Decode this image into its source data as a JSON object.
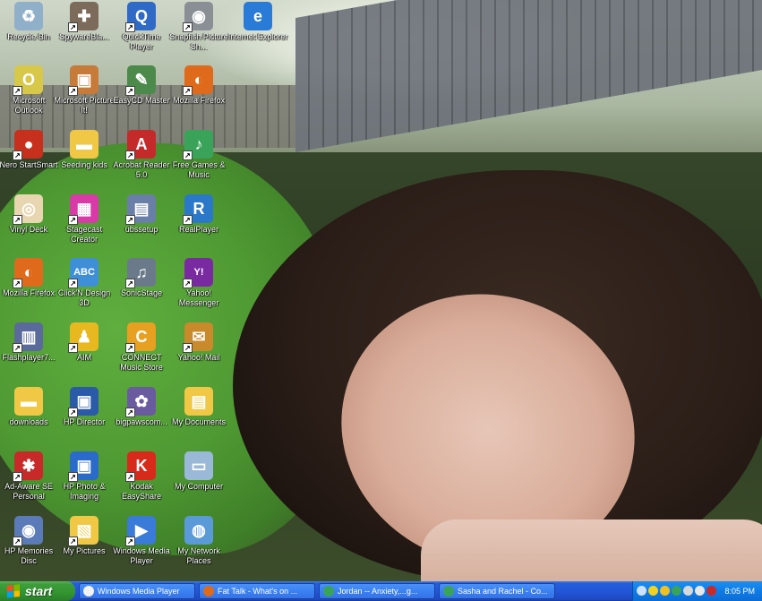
{
  "desktop": {
    "icons": [
      {
        "label": "Recycle Bin",
        "icon": "recycle-bin-icon",
        "color": "#8fb0c8",
        "glyph": "♻",
        "shortcut": false
      },
      {
        "label": "SpywareBla...",
        "icon": "spyware-blaster-icon",
        "color": "#7c6a5a",
        "glyph": "✚",
        "shortcut": true
      },
      {
        "label": "QuickTime Player",
        "icon": "quicktime-icon",
        "color": "#2f6bc6",
        "glyph": "Q",
        "shortcut": true
      },
      {
        "label": "Snapfish Picture Sh...",
        "icon": "snapfish-icon",
        "color": "#8a8f96",
        "glyph": "◉",
        "shortcut": true
      },
      {
        "label": "Internet Explorer",
        "icon": "internet-explorer-icon",
        "color": "#2a7ad8",
        "glyph": "e",
        "shortcut": false
      },
      {
        "label": "Microsoft Outlook",
        "icon": "outlook-icon",
        "color": "#d8c84a",
        "glyph": "O",
        "shortcut": true
      },
      {
        "label": "Microsoft Picture It!",
        "icon": "picture-it-icon",
        "color": "#c77b3a",
        "glyph": "▣",
        "shortcut": true
      },
      {
        "label": "EasyCD Master",
        "icon": "easycd-icon",
        "color": "#4c8a4c",
        "glyph": "✎",
        "shortcut": true
      },
      {
        "label": "Mozilla Firefox",
        "icon": "firefox-icon",
        "color": "#e06a1c",
        "glyph": "◐",
        "shortcut": true
      },
      {
        "label": "Nero StartSmart",
        "icon": "nero-icon",
        "color": "#c8301e",
        "glyph": "●",
        "shortcut": true
      },
      {
        "label": "Seeding kids",
        "icon": "folder-icon",
        "color": "#f0c845",
        "glyph": "▬",
        "shortcut": false
      },
      {
        "label": "Acrobat Reader 5.0",
        "icon": "acrobat-icon",
        "color": "#c42a2a",
        "glyph": "A",
        "shortcut": true
      },
      {
        "label": "Free Games & Music",
        "icon": "free-games-icon",
        "color": "#3aa35a",
        "glyph": "♪",
        "shortcut": true
      },
      {
        "label": "Vinyl Deck",
        "icon": "vinyl-deck-icon",
        "color": "#e8d6b0",
        "glyph": "◎",
        "shortcut": true
      },
      {
        "label": "Stagecast Creator",
        "icon": "stagecast-icon",
        "color": "#d83aa8",
        "glyph": "▦",
        "shortcut": true
      },
      {
        "label": "ubssetup",
        "icon": "setup-icon",
        "color": "#6a7fa8",
        "glyph": "▤",
        "shortcut": true
      },
      {
        "label": "RealPlayer",
        "icon": "realplayer-icon",
        "color": "#2b78c8",
        "glyph": "R",
        "shortcut": true
      },
      {
        "label": "Mozilla Firefox",
        "icon": "firefox-icon",
        "color": "#e06a1c",
        "glyph": "◐",
        "shortcut": true
      },
      {
        "label": "Click'N Design 3D",
        "icon": "clickn-design-icon",
        "color": "#3f8fd8",
        "glyph": "ABC",
        "shortcut": true
      },
      {
        "label": "SonicStage",
        "icon": "sonicstage-icon",
        "color": "#6a7a8a",
        "glyph": "♫",
        "shortcut": true
      },
      {
        "label": "Yahoo! Messenger",
        "icon": "yahoo-messenger-icon",
        "color": "#7a2aa0",
        "glyph": "Y!",
        "shortcut": true
      },
      {
        "label": "Flashplayer7...",
        "icon": "flashplayer-setup-icon",
        "color": "#5a6a9a",
        "glyph": "▥",
        "shortcut": true
      },
      {
        "label": "AIM",
        "icon": "aim-icon",
        "color": "#e8b820",
        "glyph": "♟",
        "shortcut": true
      },
      {
        "label": "CONNECT Music Store",
        "icon": "connect-music-icon",
        "color": "#e8a020",
        "glyph": "C",
        "shortcut": true
      },
      {
        "label": "Yahoo! Mail",
        "icon": "yahoo-mail-icon",
        "color": "#c88a2a",
        "glyph": "✉",
        "shortcut": true
      },
      {
        "label": "downloads",
        "icon": "folder-icon",
        "color": "#f0c845",
        "glyph": "▬",
        "shortcut": false
      },
      {
        "label": "HP Director",
        "icon": "hp-director-icon",
        "color": "#2a5aa8",
        "glyph": "▣",
        "shortcut": true
      },
      {
        "label": "bigpawscom...",
        "icon": "bigpaws-icon",
        "color": "#6a5aa0",
        "glyph": "✿",
        "shortcut": true
      },
      {
        "label": "My Documents",
        "icon": "my-documents-icon",
        "color": "#f0c845",
        "glyph": "▤",
        "shortcut": false
      },
      {
        "label": "Ad-Aware SE Personal",
        "icon": "ad-aware-icon",
        "color": "#c82a2a",
        "glyph": "✱",
        "shortcut": true
      },
      {
        "label": "HP Photo & Imaging",
        "icon": "hp-photo-icon",
        "color": "#2a6ac8",
        "glyph": "▣",
        "shortcut": true
      },
      {
        "label": "Kodak EasyShare",
        "icon": "kodak-icon",
        "color": "#d82a1a",
        "glyph": "K",
        "shortcut": true
      },
      {
        "label": "My Computer",
        "icon": "my-computer-icon",
        "color": "#9ab8d8",
        "glyph": "▭",
        "shortcut": false
      },
      {
        "label": "HP Memories Disc",
        "icon": "hp-memories-icon",
        "color": "#5a7ab8",
        "glyph": "◉",
        "shortcut": true
      },
      {
        "label": "My Pictures",
        "icon": "my-pictures-icon",
        "color": "#f0c845",
        "glyph": "▧",
        "shortcut": true
      },
      {
        "label": "Windows Media Player",
        "icon": "windows-media-player-icon",
        "color": "#3a7ad8",
        "glyph": "▶",
        "shortcut": true
      },
      {
        "label": "My Network Places",
        "icon": "my-network-places-icon",
        "color": "#5a9ad8",
        "glyph": "◍",
        "shortcut": false
      }
    ]
  },
  "taskbar": {
    "start_label": "start",
    "tasks": [
      {
        "label": "Windows Media Player",
        "icon": "windows-media-player-icon",
        "color": "#f2f2f2"
      },
      {
        "label": "Fat Talk - What's on ...",
        "icon": "firefox-icon",
        "color": "#e06a1c"
      },
      {
        "label": "Jordan -- Anxiety,...g...",
        "icon": "msn-messenger-icon",
        "color": "#3aa35a"
      },
      {
        "label": "Sasha and Rachel - Co...",
        "icon": "msn-messenger-icon",
        "color": "#3aa35a"
      }
    ],
    "tray_icons": [
      {
        "icon": "chevron-left-icon",
        "color": "#cfe2fb"
      },
      {
        "icon": "yahoo-messenger-icon",
        "color": "#f2d21e"
      },
      {
        "icon": "aim-icon",
        "color": "#f0c020"
      },
      {
        "icon": "msn-messenger-icon",
        "color": "#3aa35a"
      },
      {
        "icon": "network-icon",
        "color": "#d8d8d8"
      },
      {
        "icon": "volume-icon",
        "color": "#e8e8e8"
      },
      {
        "icon": "security-icon",
        "color": "#c82a2a"
      }
    ],
    "clock": "8:05 PM"
  }
}
